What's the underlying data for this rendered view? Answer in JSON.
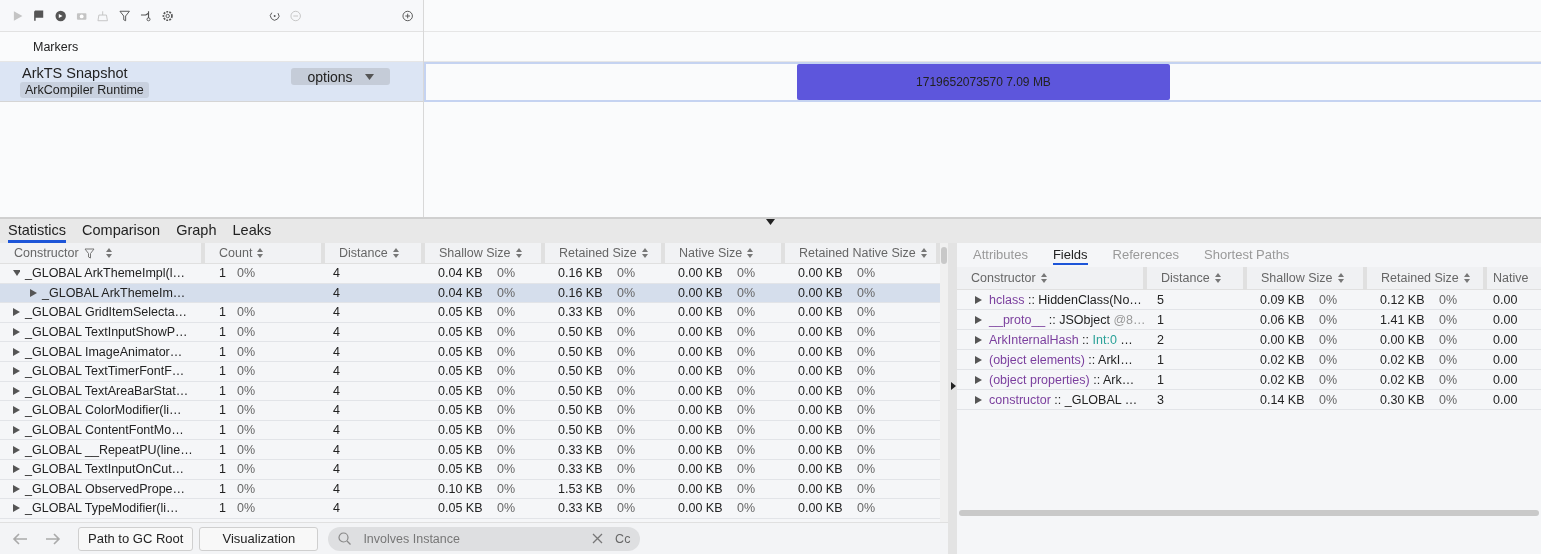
{
  "toolbar": [
    {
      "kind": "play",
      "disabled": true
    },
    {
      "kind": "flag",
      "disabled": false
    },
    {
      "kind": "record",
      "disabled": false
    },
    {
      "kind": "camera",
      "disabled": true
    },
    {
      "kind": "broom",
      "disabled": true
    },
    {
      "kind": "filter",
      "disabled": false
    },
    {
      "kind": "branch",
      "disabled": false
    },
    {
      "kind": "gear",
      "disabled": false
    },
    {
      "kind": "reload",
      "disabled": false
    },
    {
      "kind": "minus",
      "disabled": true
    },
    {
      "kind": "plus",
      "disabled": false
    }
  ],
  "tracks": {
    "markers": "Markers",
    "snapshot": {
      "title": "ArkTS Snapshot",
      "tag": "ArkCompiler Runtime",
      "dropdown": "options",
      "selected": true
    }
  },
  "timeline": {
    "snapshots": [
      {
        "label": "1719652073570 7.09 MB",
        "selected": true
      }
    ]
  },
  "main_tabs": [
    {
      "label": "Statistics",
      "selected": true
    },
    {
      "label": "Comparison",
      "selected": false
    },
    {
      "label": "Graph",
      "selected": false
    },
    {
      "label": "Leaks",
      "selected": false
    }
  ],
  "statistics": {
    "columns": [
      {
        "label": "Constructor",
        "filter": true
      },
      {
        "label": "Count"
      },
      {
        "label": "Distance"
      },
      {
        "label": "Shallow Size"
      },
      {
        "label": "Retained Size"
      },
      {
        "label": "Native Size"
      },
      {
        "label": "Retained Native Size"
      }
    ],
    "rows": [
      {
        "name": "_GLOBAL ArkThemeImpl(l…",
        "count": [
          "1",
          "0%"
        ],
        "distance": "4",
        "sizes": [
          [
            "0.04 KB",
            "0%"
          ],
          [
            "0.16 KB",
            "0%"
          ],
          [
            "0.00 KB",
            "0%"
          ],
          [
            "0.00 KB",
            "0%"
          ]
        ],
        "expanded": true,
        "selected": false,
        "children": [
          {
            "name": "_GLOBAL ArkThemeIm…",
            "distance": "4",
            "sizes": [
              [
                "0.04 KB",
                "0%"
              ],
              [
                "0.16 KB",
                "0%"
              ],
              [
                "0.00 KB",
                "0%"
              ],
              [
                "0.00 KB",
                "0%"
              ]
            ],
            "expanded": false,
            "selected": true
          }
        ]
      },
      {
        "name": "_GLOBAL GridItemSelecta…",
        "count": [
          "1",
          "0%"
        ],
        "distance": "4",
        "sizes": [
          [
            "0.05 KB",
            "0%"
          ],
          [
            "0.33 KB",
            "0%"
          ],
          [
            "0.00 KB",
            "0%"
          ],
          [
            "0.00 KB",
            "0%"
          ]
        ],
        "expanded": false,
        "selected": false
      },
      {
        "name": "_GLOBAL TextInputShowP…",
        "count": [
          "1",
          "0%"
        ],
        "distance": "4",
        "sizes": [
          [
            "0.05 KB",
            "0%"
          ],
          [
            "0.50 KB",
            "0%"
          ],
          [
            "0.00 KB",
            "0%"
          ],
          [
            "0.00 KB",
            "0%"
          ]
        ],
        "expanded": false,
        "selected": false
      },
      {
        "name": "_GLOBAL ImageAnimator…",
        "count": [
          "1",
          "0%"
        ],
        "distance": "4",
        "sizes": [
          [
            "0.05 KB",
            "0%"
          ],
          [
            "0.50 KB",
            "0%"
          ],
          [
            "0.00 KB",
            "0%"
          ],
          [
            "0.00 KB",
            "0%"
          ]
        ],
        "expanded": false,
        "selected": false
      },
      {
        "name": "_GLOBAL TextTimerFontF…",
        "count": [
          "1",
          "0%"
        ],
        "distance": "4",
        "sizes": [
          [
            "0.05 KB",
            "0%"
          ],
          [
            "0.50 KB",
            "0%"
          ],
          [
            "0.00 KB",
            "0%"
          ],
          [
            "0.00 KB",
            "0%"
          ]
        ],
        "expanded": false,
        "selected": false
      },
      {
        "name": "_GLOBAL TextAreaBarStat…",
        "count": [
          "1",
          "0%"
        ],
        "distance": "4",
        "sizes": [
          [
            "0.05 KB",
            "0%"
          ],
          [
            "0.50 KB",
            "0%"
          ],
          [
            "0.00 KB",
            "0%"
          ],
          [
            "0.00 KB",
            "0%"
          ]
        ],
        "expanded": false,
        "selected": false
      },
      {
        "name": "_GLOBAL ColorModifier(li…",
        "count": [
          "1",
          "0%"
        ],
        "distance": "4",
        "sizes": [
          [
            "0.05 KB",
            "0%"
          ],
          [
            "0.50 KB",
            "0%"
          ],
          [
            "0.00 KB",
            "0%"
          ],
          [
            "0.00 KB",
            "0%"
          ]
        ],
        "expanded": false,
        "selected": false
      },
      {
        "name": "_GLOBAL ContentFontMo…",
        "count": [
          "1",
          "0%"
        ],
        "distance": "4",
        "sizes": [
          [
            "0.05 KB",
            "0%"
          ],
          [
            "0.50 KB",
            "0%"
          ],
          [
            "0.00 KB",
            "0%"
          ],
          [
            "0.00 KB",
            "0%"
          ]
        ],
        "expanded": false,
        "selected": false
      },
      {
        "name": "_GLOBAL __RepeatPU(line…",
        "count": [
          "1",
          "0%"
        ],
        "distance": "4",
        "sizes": [
          [
            "0.05 KB",
            "0%"
          ],
          [
            "0.33 KB",
            "0%"
          ],
          [
            "0.00 KB",
            "0%"
          ],
          [
            "0.00 KB",
            "0%"
          ]
        ],
        "expanded": false,
        "selected": false
      },
      {
        "name": "_GLOBAL TextInputOnCut…",
        "count": [
          "1",
          "0%"
        ],
        "distance": "4",
        "sizes": [
          [
            "0.05 KB",
            "0%"
          ],
          [
            "0.33 KB",
            "0%"
          ],
          [
            "0.00 KB",
            "0%"
          ],
          [
            "0.00 KB",
            "0%"
          ]
        ],
        "expanded": false,
        "selected": false
      },
      {
        "name": "_GLOBAL ObservedPrope…",
        "count": [
          "1",
          "0%"
        ],
        "distance": "4",
        "sizes": [
          [
            "0.10 KB",
            "0%"
          ],
          [
            "1.53 KB",
            "0%"
          ],
          [
            "0.00 KB",
            "0%"
          ],
          [
            "0.00 KB",
            "0%"
          ]
        ],
        "expanded": false,
        "selected": false
      },
      {
        "name": "_GLOBAL TypeModifier(li…",
        "count": [
          "1",
          "0%"
        ],
        "distance": "4",
        "sizes": [
          [
            "0.05 KB",
            "0%"
          ],
          [
            "0.33 KB",
            "0%"
          ],
          [
            "0.00 KB",
            "0%"
          ],
          [
            "0.00 KB",
            "0%"
          ]
        ],
        "expanded": false,
        "selected": false
      }
    ]
  },
  "footer": {
    "buttons": [
      "Path to GC Root",
      "Visualization"
    ],
    "search": {
      "placeholder": "Involves Instance",
      "case_toggle": "Cc"
    }
  },
  "detail": {
    "tabs": [
      {
        "label": "Attributes",
        "selected": false
      },
      {
        "label": "Fields",
        "selected": true
      },
      {
        "label": "References",
        "selected": false
      },
      {
        "label": "Shortest Paths",
        "selected": false
      }
    ],
    "columns": [
      {
        "label": "Constructor"
      },
      {
        "label": "Distance"
      },
      {
        "label": "Shallow Size"
      },
      {
        "label": "Retained Size"
      },
      {
        "label": "Native"
      }
    ],
    "rows": [
      {
        "segments": [
          {
            "text": "hclass",
            "kind": "field"
          },
          {
            "text": " :: HiddenClass(No…",
            "kind": "type"
          }
        ],
        "distance": "5",
        "sizes": [
          [
            "0.09 KB",
            "0%"
          ],
          [
            "0.12 KB",
            "0%"
          ]
        ],
        "native": "0.00"
      },
      {
        "segments": [
          {
            "text": "__proto__",
            "kind": "field"
          },
          {
            "text": " :: JSObject ",
            "kind": "type"
          },
          {
            "text": "@8…",
            "kind": "address"
          }
        ],
        "distance": "1",
        "sizes": [
          [
            "0.06 KB",
            "0%"
          ],
          [
            "1.41 KB",
            "0%"
          ]
        ],
        "native": "0.00"
      },
      {
        "segments": [
          {
            "text": "ArkInternalHash",
            "kind": "field"
          },
          {
            "text": " :: ",
            "kind": "type"
          },
          {
            "text": "Int:0",
            "kind": "primitive"
          },
          {
            "text": " …",
            "kind": "type"
          }
        ],
        "distance": "2",
        "sizes": [
          [
            "0.00 KB",
            "0%"
          ],
          [
            "0.00 KB",
            "0%"
          ]
        ],
        "native": "0.00"
      },
      {
        "segments": [
          {
            "text": "(object elements)",
            "kind": "field"
          },
          {
            "text": " :: ArkI…",
            "kind": "type"
          }
        ],
        "distance": "1",
        "sizes": [
          [
            "0.02 KB",
            "0%"
          ],
          [
            "0.02 KB",
            "0%"
          ]
        ],
        "native": "0.00"
      },
      {
        "segments": [
          {
            "text": "(object properties)",
            "kind": "field"
          },
          {
            "text": " :: Ark…",
            "kind": "type"
          }
        ],
        "distance": "1",
        "sizes": [
          [
            "0.02 KB",
            "0%"
          ],
          [
            "0.02 KB",
            "0%"
          ]
        ],
        "native": "0.00"
      },
      {
        "segments": [
          {
            "text": "constructor",
            "kind": "field"
          },
          {
            "text": " :: _GLOBAL …",
            "kind": "type"
          }
        ],
        "distance": "3",
        "sizes": [
          [
            "0.14 KB",
            "0%"
          ],
          [
            "0.30 KB",
            "0%"
          ]
        ],
        "native": "0.00"
      }
    ]
  }
}
